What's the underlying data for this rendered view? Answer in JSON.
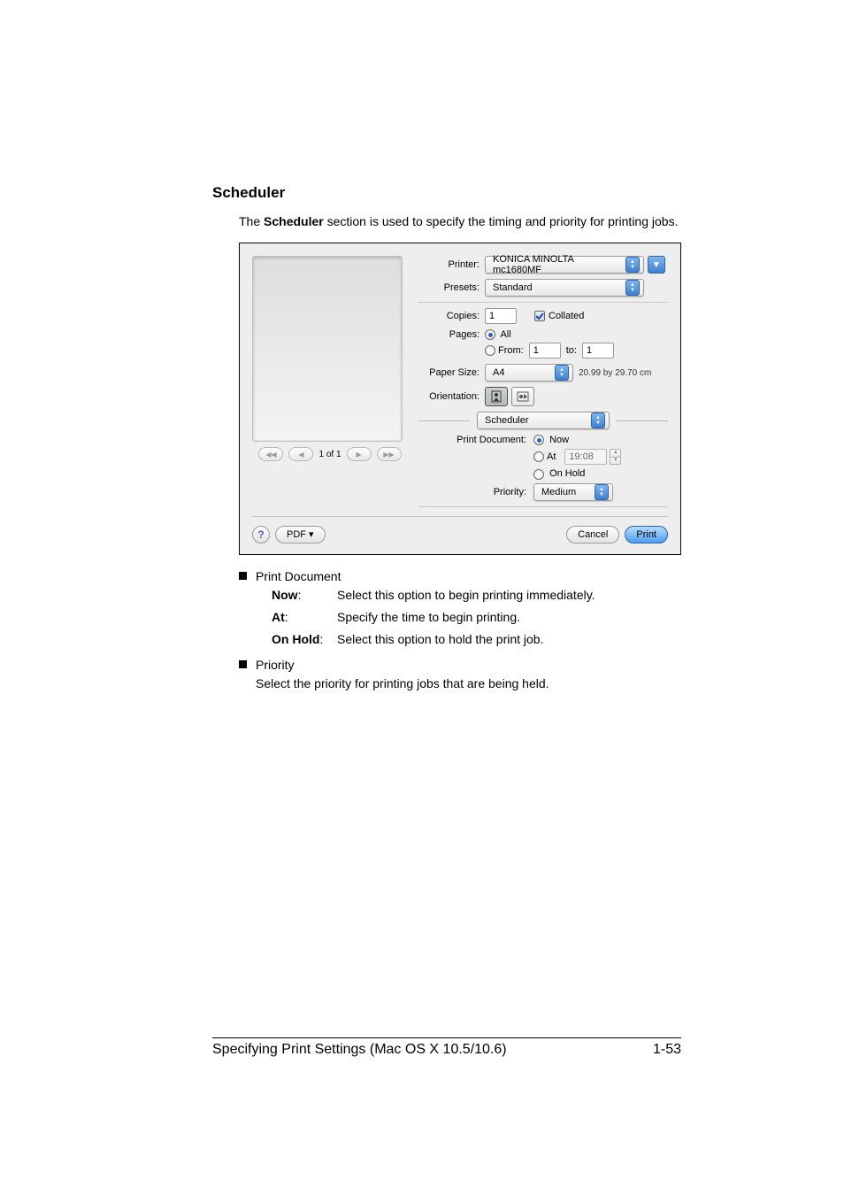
{
  "heading": "Scheduler",
  "intro_before": "The ",
  "intro_bold": "Scheduler",
  "intro_after": " section is used to specify the timing and priority for printing jobs.",
  "dialog": {
    "printer_label": "Printer:",
    "printer_value": "KONICA MINOLTA mc1680MF",
    "presets_label": "Presets:",
    "presets_value": "Standard",
    "copies_label": "Copies:",
    "copies_value": "1",
    "collated_label": "Collated",
    "pages_label": "Pages:",
    "pages_all": "All",
    "pages_from": "From:",
    "pages_from_value": "1",
    "pages_to": "to:",
    "pages_to_value": "1",
    "papersize_label": "Paper Size:",
    "papersize_value": "A4",
    "paper_dim": "20.99 by 29.70 cm",
    "orientation_label": "Orientation:",
    "section_select": "Scheduler",
    "print_doc_label": "Print Document:",
    "now": "Now",
    "at": "At",
    "at_time": "19:08",
    "onhold": "On Hold",
    "priority_label": "Priority:",
    "priority_value": "Medium",
    "pager": "1 of 1",
    "pdf_btn": "PDF ▾",
    "cancel": "Cancel",
    "print": "Print"
  },
  "bullets": {
    "print_document": "Print Document",
    "now_term": "Now",
    "now_desc": "Select this option to begin printing immediately.",
    "at_term": "At",
    "at_desc": "Specify the time to begin printing.",
    "onhold_term": "On Hold",
    "onhold_desc": "Select this option to hold the print job.",
    "priority": "Priority",
    "priority_desc": "Select the priority for printing jobs that are being held."
  },
  "footer": {
    "left": "Specifying Print Settings (Mac OS X 10.5/10.6)",
    "right": "1-53"
  }
}
